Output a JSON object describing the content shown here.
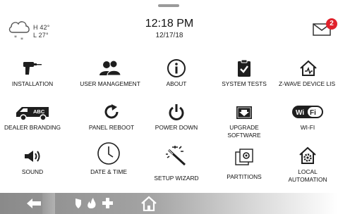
{
  "header": {
    "weather": {
      "icon": "cloud-snow-icon",
      "high": "H 42°",
      "low": "L 27°"
    },
    "time": "12:18 PM",
    "date": "12/17/18",
    "messages": {
      "icon": "envelope-icon",
      "count": "2"
    }
  },
  "tiles": [
    {
      "id": "installation",
      "label": "INSTALLATION",
      "icon": "drill-icon"
    },
    {
      "id": "user-management",
      "label": "USER MANAGEMENT",
      "icon": "users-icon"
    },
    {
      "id": "about",
      "label": "ABOUT",
      "icon": "info-icon"
    },
    {
      "id": "system-tests",
      "label": "SYSTEM TESTS",
      "icon": "clipboard-check-icon"
    },
    {
      "id": "zwave-device-list",
      "label": "Z-WAVE DEVICE LIS",
      "icon": "home-zwave-icon"
    },
    {
      "id": "dealer-branding",
      "label": "DEALER BRANDING",
      "icon": "van-icon",
      "icon_text": "ABC"
    },
    {
      "id": "panel-reboot",
      "label": "PANEL REBOOT",
      "icon": "refresh-icon"
    },
    {
      "id": "power-down",
      "label": "POWER DOWN",
      "icon": "power-icon"
    },
    {
      "id": "upgrade-software",
      "label": "UPGRADE\nSOFTWARE",
      "icon": "download-box-icon"
    },
    {
      "id": "wifi",
      "label": "WI-FI",
      "icon": "wifi-badge-icon",
      "icon_text": "Wi Fi"
    },
    {
      "id": "sound",
      "label": "SOUND",
      "icon": "speaker-icon"
    },
    {
      "id": "date-time",
      "label": "DATE & TIME",
      "icon": "clock-icon"
    },
    {
      "id": "setup-wizard",
      "label": "SETUP WIZARD",
      "icon": "magic-wand-icon"
    },
    {
      "id": "partitions",
      "label": "PARTITIONS",
      "icon": "partitions-icon"
    },
    {
      "id": "local-automation",
      "label": "LOCAL\nAUTOMATION",
      "icon": "home-gear-icon"
    }
  ],
  "bottom_bar": {
    "buttons": [
      {
        "id": "back",
        "icon": "arrow-left-icon"
      },
      {
        "id": "emergency",
        "icon": "emergency-icons"
      },
      {
        "id": "home",
        "icon": "home-icon"
      }
    ],
    "colors": {
      "bar_dark": "#8a8a8a",
      "bar_light": "#ffffff",
      "icon": "#ffffff"
    }
  },
  "colors": {
    "badge": "#e0212b",
    "icon": "#1e1e1e",
    "text": "#111111"
  }
}
